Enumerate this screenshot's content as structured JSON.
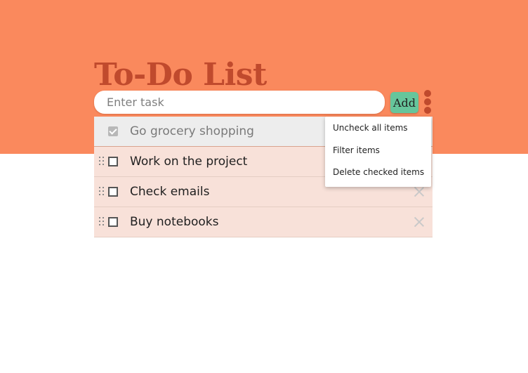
{
  "header": {
    "title": "To-Do List"
  },
  "task_input": {
    "placeholder": "Enter task",
    "value": ""
  },
  "add_label": "Add",
  "items": [
    {
      "label": "Go grocery shopping",
      "checked": true
    },
    {
      "label": "Work on the project",
      "checked": false
    },
    {
      "label": "Check emails",
      "checked": false
    },
    {
      "label": "Buy notebooks",
      "checked": false
    }
  ],
  "menu": {
    "options": [
      "Uncheck all items",
      "Filter items",
      "Delete checked items"
    ]
  },
  "icons": {
    "menu": "more-vertical-icon",
    "drag": "drag-handle-icon",
    "checkbox": "checkbox-icon",
    "delete": "close-icon"
  },
  "colors": {
    "hero_background": "#fa895d",
    "title": "#c04a2d",
    "add_button": "#66c59b",
    "item_background": "#f8e1d9",
    "checked_item_background": "#ededed"
  }
}
